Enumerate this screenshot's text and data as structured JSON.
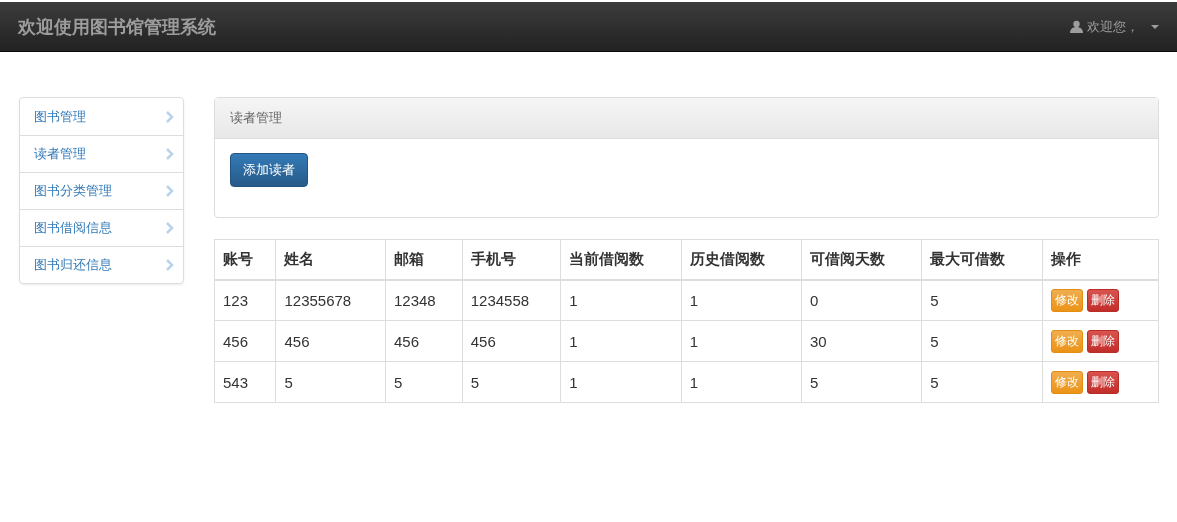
{
  "navbar": {
    "brand": "欢迎使用图书馆管理系统",
    "user_menu": "欢迎您，"
  },
  "sidebar": {
    "items": [
      {
        "label": "图书管理"
      },
      {
        "label": "读者管理"
      },
      {
        "label": "图书分类管理"
      },
      {
        "label": "图书借阅信息"
      },
      {
        "label": "图书归还信息"
      }
    ]
  },
  "panel": {
    "title": "读者管理",
    "add_button": "添加读者"
  },
  "table": {
    "columns": [
      "账号",
      "姓名",
      "邮箱",
      "手机号",
      "当前借阅数",
      "历史借阅数",
      "可借阅天数",
      "最大可借数",
      "操作"
    ],
    "rows": [
      {
        "cells": [
          "123",
          "12355678",
          "12348",
          "1234558",
          "1",
          "1",
          "0",
          "5"
        ],
        "edit": "修改",
        "delete": "删除"
      },
      {
        "cells": [
          "456",
          "456",
          "456",
          "456",
          "1",
          "1",
          "30",
          "5"
        ],
        "edit": "修改",
        "delete": "删除"
      },
      {
        "cells": [
          "543",
          "5",
          "5",
          "5",
          "1",
          "1",
          "5",
          "5"
        ],
        "edit": "修改",
        "delete": "删除"
      }
    ]
  }
}
